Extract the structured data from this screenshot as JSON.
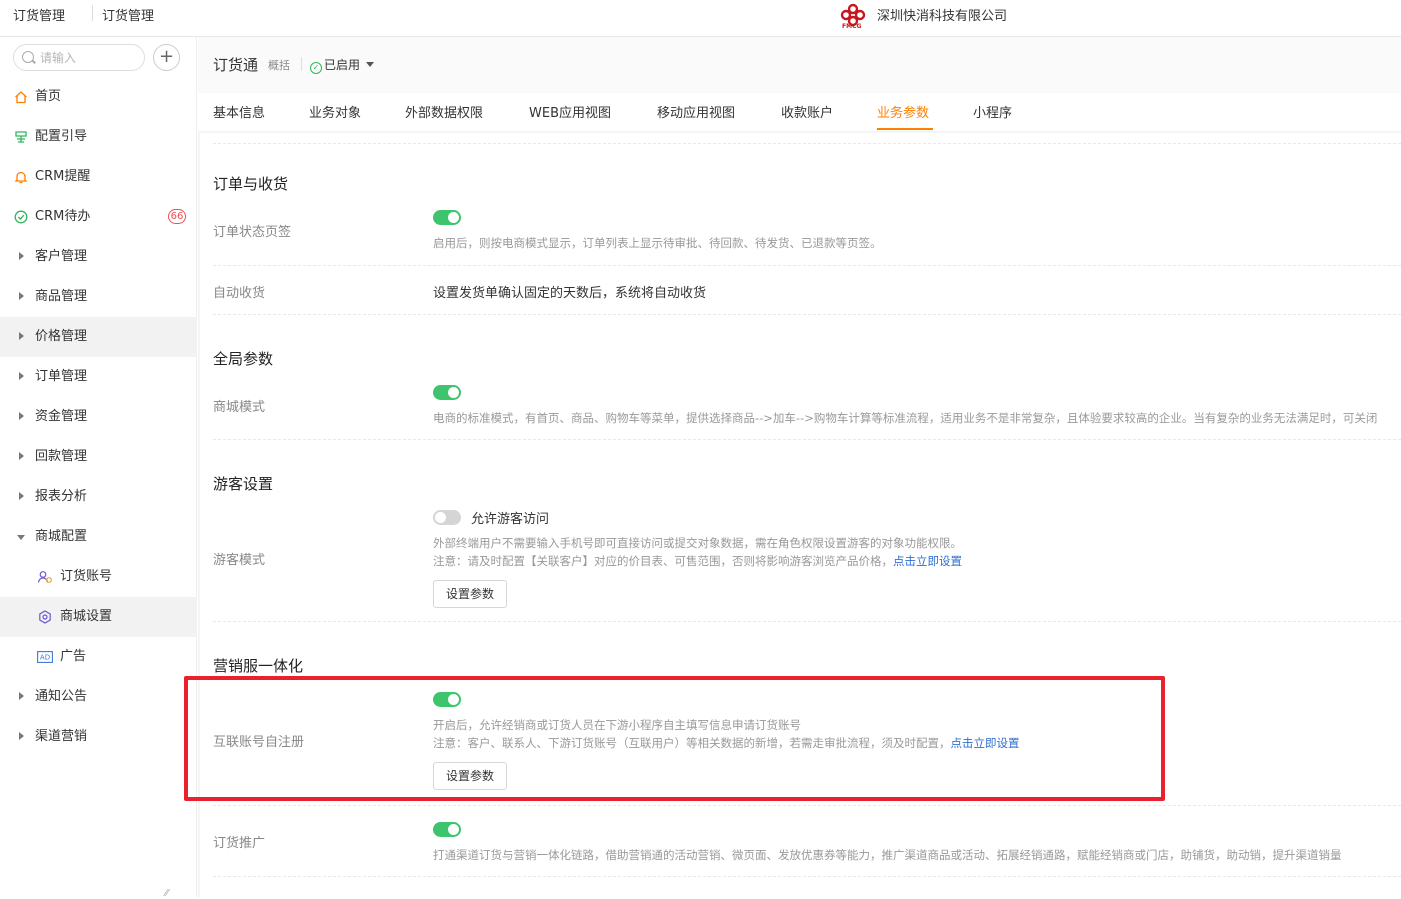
{
  "topbar": {
    "tab1": "订货管理",
    "tab2": "订货管理",
    "logo_sub": "FMCG",
    "company": "深圳快消科技有限公司"
  },
  "sidebar": {
    "search_placeholder": "请输入",
    "add_label": "+",
    "badge": "66",
    "items": [
      {
        "label": "首页",
        "icon": "home-icon"
      },
      {
        "label": "配置引导",
        "icon": "guide-icon"
      },
      {
        "label": "CRM提醒",
        "icon": "bell-icon"
      },
      {
        "label": "CRM待办",
        "icon": "check-circle-icon"
      },
      {
        "label": "客户管理",
        "icon": "caret-right-icon"
      },
      {
        "label": "商品管理",
        "icon": "caret-right-icon"
      },
      {
        "label": "价格管理",
        "icon": "caret-right-icon"
      },
      {
        "label": "订单管理",
        "icon": "caret-right-icon"
      },
      {
        "label": "资金管理",
        "icon": "caret-right-icon"
      },
      {
        "label": "回款管理",
        "icon": "caret-right-icon"
      },
      {
        "label": "报表分析",
        "icon": "caret-right-icon"
      },
      {
        "label": "商城配置",
        "icon": "caret-down-icon"
      },
      {
        "label": "订货账号",
        "icon": "users-icon"
      },
      {
        "label": "商城设置",
        "icon": "settings-icon"
      },
      {
        "label": "广告",
        "icon": "ad-icon"
      },
      {
        "label": "通知公告",
        "icon": "caret-right-icon"
      },
      {
        "label": "渠道营销",
        "icon": "caret-right-icon"
      }
    ]
  },
  "header": {
    "title": "订货通",
    "subtitle": "概括",
    "status": "已启用"
  },
  "tabs": [
    "基本信息",
    "业务对象",
    "外部数据权限",
    "WEB应用视图",
    "移动应用视图",
    "收款账户",
    "业务参数",
    "小程序"
  ],
  "sections": {
    "order": {
      "title": "订单与收货",
      "status_tab_label": "订单状态页签",
      "status_tab_desc": "启用后，则按电商模式显示，订单列表上显示待审批、待回款、待发货、已退款等页签。",
      "auto_receive_label": "自动收货",
      "auto_receive_text": "设置发货单确认固定的天数后，系统将自动收货"
    },
    "global": {
      "title": "全局参数",
      "mall_mode_label": "商城模式",
      "mall_mode_desc": "电商的标准模式，有首页、商品、购物车等菜单，提供选择商品-->加车-->购物车计算等标准流程，适用业务不是非常复杂，且体验要求较高的企业。当有复杂的业务无法满足时，可关闭"
    },
    "guest": {
      "title": "游客设置",
      "mode_label": "游客模式",
      "allow_label": "允许游客访问",
      "desc1": "外部终端用户不需要输入手机号即可直接访问或提交对象数据，需在角色权限设置游客的对象功能权限。",
      "desc2": "注意：请及时配置【关联客户】对应的价目表、可售范围，否则将影响游客浏览产品价格，",
      "link": "点击立即设置",
      "button": "设置参数"
    },
    "marketing": {
      "title": "营销服一体化",
      "self_reg_label": "互联账号自注册",
      "self_reg_desc1": "开启后，允许经销商或订货人员在下游小程序自主填写信息申请订货账号",
      "self_reg_desc2": "注意：客户、联系人、下游订货账号（互联用户）等相关数据的新增，若需走审批流程，须及时配置，",
      "link": "点击立即设置",
      "button": "设置参数",
      "promo_label": "订货推广",
      "promo_desc": "打通渠道订货与营销一体化链路，借助营销通的活动营销、微页面、发放优惠券等能力，推广渠道商品或活动、拓展经销通路，赋能经销商或门店，助铺货，助动销，提升渠道销量"
    }
  },
  "colors": {
    "accent": "#ff8000",
    "toggle_on": "#3ec46d",
    "link": "#2f6fd0",
    "highlight_box": "#e8212c"
  }
}
